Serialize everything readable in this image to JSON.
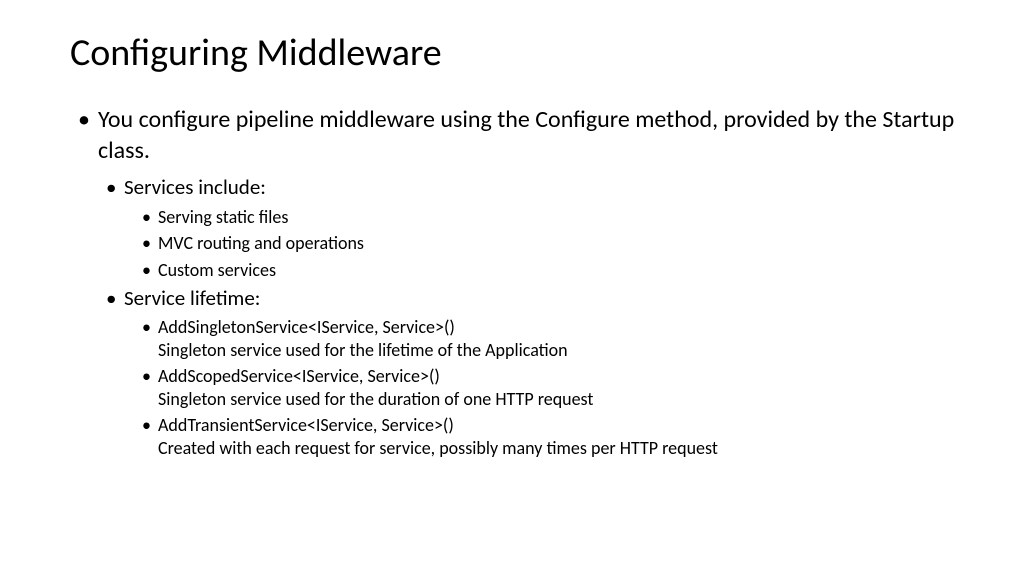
{
  "title": "Configuring Middleware",
  "bullets": {
    "main": "You configure pipeline middleware using the Configure method, provided by the Startup class.",
    "services_header": "Services include:",
    "services": {
      "item1": "Serving static files",
      "item2": "MVC routing and operations",
      "item3": "Custom services"
    },
    "lifetime_header": "Service lifetime:",
    "lifetime": {
      "singleton_line1": "AddSingletonService<IService, Service>()",
      "singleton_line2": "Singleton service used for the lifetime of the Application",
      "scoped_line1": "AddScopedService<IService, Service>()",
      "scoped_line2": "Singleton service used for the duration of one HTTP request",
      "transient_line1": "AddTransientService<IService, Service>()",
      "transient_line2": "Created with each request for service, possibly many times per HTTP request"
    }
  }
}
